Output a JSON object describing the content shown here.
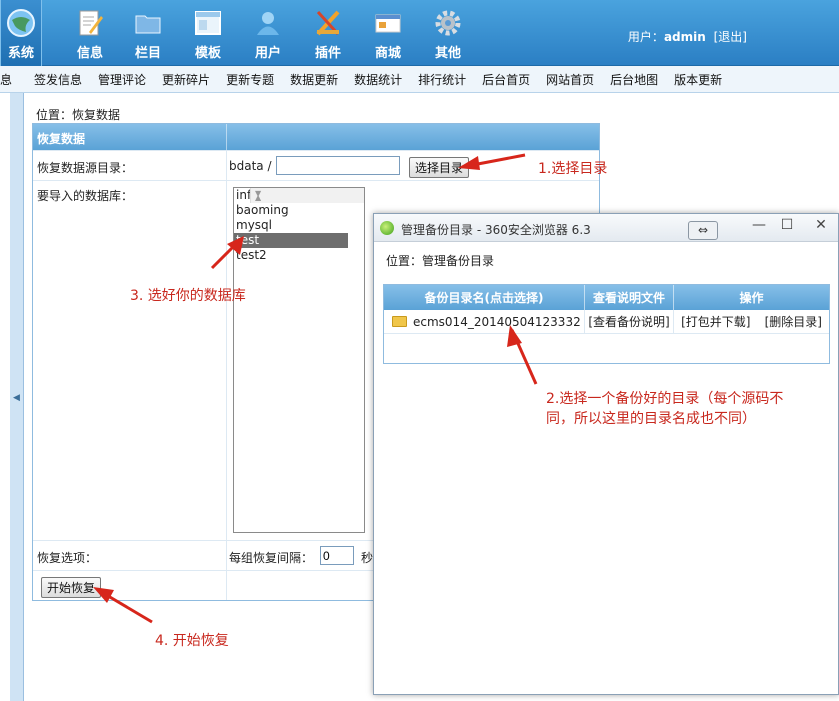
{
  "header": {
    "nav": [
      {
        "label": "系统",
        "icon": "globe-icon"
      },
      {
        "label": "信息",
        "icon": "document-pen-icon"
      },
      {
        "label": "栏目",
        "icon": "folder-icon"
      },
      {
        "label": "模板",
        "icon": "template-window-icon"
      },
      {
        "label": "用户",
        "icon": "user-icon"
      },
      {
        "label": "插件",
        "icon": "tools-icon"
      },
      {
        "label": "商城",
        "icon": "shop-card-icon"
      },
      {
        "label": "其他",
        "icon": "gear-icon"
      }
    ],
    "user_prefix": "用户：",
    "user_name": "admin",
    "logout": "[退出]"
  },
  "submenu": [
    "息",
    "签发信息",
    "管理评论",
    "更新碎片",
    "更新专题",
    "数据更新",
    "数据统计",
    "排行统计",
    "后台首页",
    "网站首页",
    "后台地图",
    "版本更新"
  ],
  "location": "位置：恢复数据",
  "form": {
    "title": "恢复数据",
    "source_label": "恢复数据源目录：",
    "source_prefix": "bdata /",
    "source_value": "",
    "select_dir_button": "选择目录",
    "db_label": "要导入的数据库：",
    "databases": [
      "information_schema",
      "baoming",
      "mysql",
      "test",
      "test2"
    ],
    "selected_db": "test",
    "options_label": "恢复选项：",
    "interval_label": "每组恢复间隔：",
    "interval_value": "0",
    "interval_unit": "秒",
    "start_button": "开始恢复"
  },
  "popup": {
    "title": "管理备份目录 - 360安全浏览器 6.3",
    "location": "位置：管理备份目录",
    "columns": [
      "备份目录名(点击选择)",
      "查看说明文件",
      "操作"
    ],
    "rows": [
      {
        "name": "ecms014_20140504123332",
        "view": "[查看备份说明]",
        "pack": "[打包并下载]",
        "delete": "[删除目录]"
      }
    ]
  },
  "annotations": {
    "step1": "1.选择目录",
    "step2_line1": "2.选择一个备份好的目录（每个源码不",
    "step2_line2": "同，所以这里的目录名成也不同）",
    "step3": "3. 选好你的数据库",
    "step4": "4. 开始恢复"
  },
  "colors": {
    "annotation": "#c8281e",
    "header": "#2b7fc4",
    "table_head": "#5aa2d6"
  }
}
